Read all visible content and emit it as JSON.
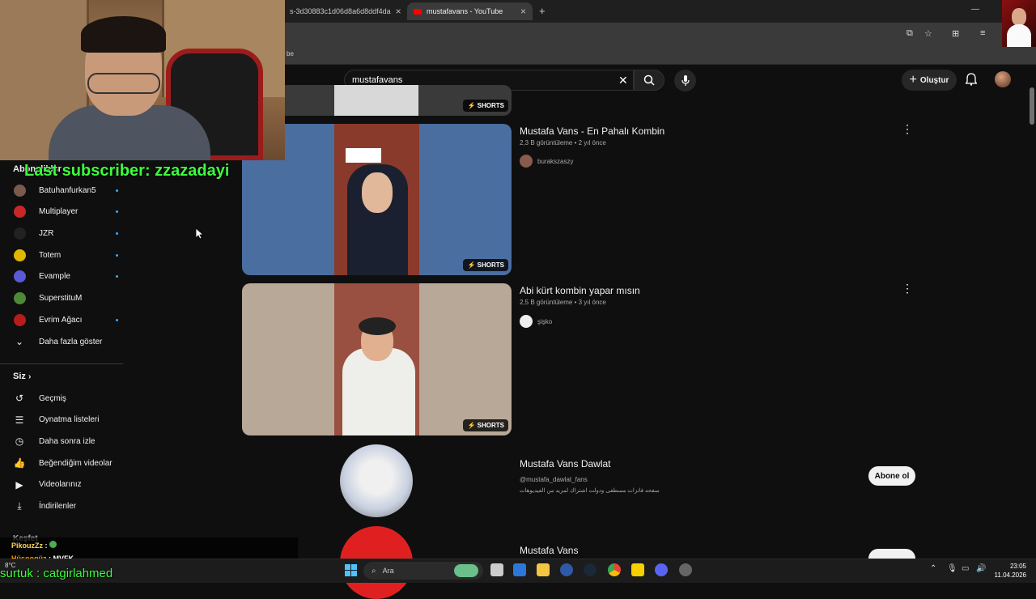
{
  "browser": {
    "tabs": [
      {
        "title": "s-3d30883c1d06d8a6d8ddf4da",
        "active": false
      },
      {
        "title": "mustafavans - YouTube",
        "active": true
      }
    ],
    "bookmark_fragment": "be"
  },
  "youtube": {
    "search": {
      "value": "mustafavans"
    },
    "create_label": "Oluştur"
  },
  "overlay": {
    "last_subscriber": "Last subscriber: zzazadayi",
    "bottom_text": "surtuk : catgirlahmed"
  },
  "sidebar": {
    "subscriptions_header": "Abonelikler",
    "channels": [
      {
        "name": "Batuhanfurkan5",
        "new": true,
        "color": "#7a5a4a"
      },
      {
        "name": "Multiplayer",
        "new": true,
        "color": "#c62828"
      },
      {
        "name": "JZR",
        "new": true,
        "color": "#222222"
      },
      {
        "name": "Totem",
        "new": true,
        "color": "#e0b800"
      },
      {
        "name": "Evample",
        "new": true,
        "color": "#5a5ad8"
      },
      {
        "name": "SuperstituM",
        "new": false,
        "color": "#4c8a3a"
      },
      {
        "name": "Evrim Ağacı",
        "new": true,
        "color": "#b71c1c"
      }
    ],
    "show_more": "Daha fazla göster",
    "you_section": "Siz",
    "you_items": [
      {
        "label": "Geçmiş",
        "icon": "history-icon"
      },
      {
        "label": "Oynatma listeleri",
        "icon": "playlist-icon"
      },
      {
        "label": "Daha sonra izle",
        "icon": "clock-icon"
      },
      {
        "label": "Beğendiğim videolar",
        "icon": "thumbs-up-icon"
      },
      {
        "label": "Videolarınız",
        "icon": "video-icon"
      },
      {
        "label": "İndirilenler",
        "icon": "download-icon"
      }
    ],
    "explore": "Keşfet"
  },
  "results": [
    {
      "title": "Mustafa Vans - En Pahalı Kombin",
      "views": "2,3 B görüntüleme",
      "age": "2 yıl önce",
      "channel": "burakszaszy",
      "badge": "SHORTS"
    },
    {
      "title": "Abi kürt kombin yapar mısın",
      "views": "2,5 B görüntüleme",
      "age": "3 yıl önce",
      "channel": "şişko",
      "badge": "SHORTS"
    }
  ],
  "partial_result_badge": "SHORTS",
  "channels_results": [
    {
      "name": "Mustafa Vans Dawlat",
      "handle": "@mustafa_dawlat_fans",
      "desc": "سفحه فانزات مسطفى ودولت اشتراك لمزيد من الفيديوهات",
      "subscribe": "Abone ol"
    },
    {
      "name": "Mustafa Vans"
    }
  ],
  "chat": [
    {
      "user": "PikouzZz",
      "msg": "",
      "color": "#ffd54f"
    },
    {
      "user": "Hüsoogüz",
      "msg": "MVFK",
      "color": "#ff9800"
    }
  ],
  "taskbar": {
    "search_label": "Ara",
    "time": "23:05",
    "date": "11.04.2026",
    "weather": "8°C"
  },
  "colors": {
    "accent_blue": "#3ea6ff",
    "overlay_green": "#3cff3c",
    "yt_red": "#ff0000"
  }
}
